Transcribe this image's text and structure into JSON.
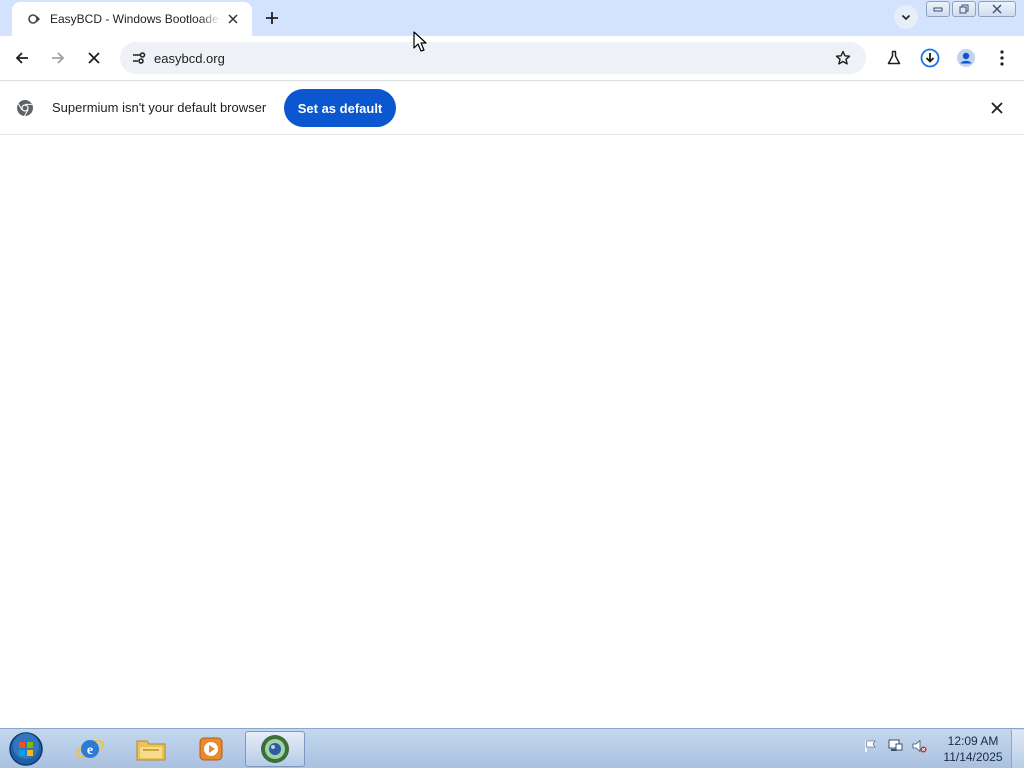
{
  "browser": {
    "tab": {
      "title": "EasyBCD - Windows Bootloader",
      "favicon": "easybcd-favicon-icon"
    },
    "address": {
      "url": "easybcd.org"
    },
    "infobar": {
      "message": "Supermium isn't your default browser",
      "button_label": "Set as default"
    },
    "colors": {
      "tabstrip": "#d3e3fd",
      "accent": "#0b57d0",
      "download_icon": "#1a73e8"
    }
  },
  "taskbar": {
    "apps": [
      "start-orb",
      "internet-explorer",
      "windows-explorer",
      "media-player",
      "supermium-browser"
    ],
    "clock": {
      "time": "12:09 AM",
      "date": "11/14/2025"
    }
  }
}
